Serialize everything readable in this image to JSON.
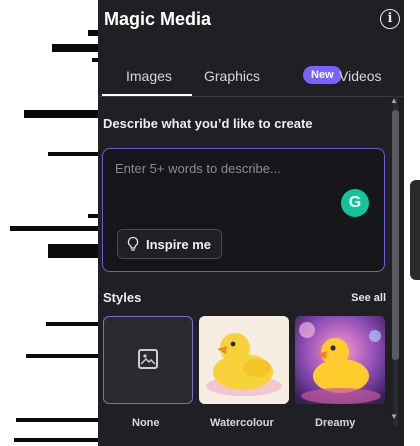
{
  "panel": {
    "title": "Magic Media",
    "info_icon": "info-icon"
  },
  "tabs": [
    {
      "label": "Images"
    },
    {
      "label": "Graphics"
    },
    {
      "label": "Videos"
    }
  ],
  "graphics_badge": "New",
  "prompt": {
    "label": "Describe what you’d like to create",
    "placeholder": "Enter 5+ words to describe...",
    "inspire_label": "Inspire me",
    "grammarly_letter": "G"
  },
  "styles": {
    "label": "Styles",
    "see_all": "See all",
    "items": [
      {
        "name": "None"
      },
      {
        "name": "Watercolour"
      },
      {
        "name": "Dreamy"
      }
    ]
  },
  "colors": {
    "panel_bg": "#1f2024",
    "accent": "#7b61ff",
    "grammarly": "#15c39a"
  }
}
